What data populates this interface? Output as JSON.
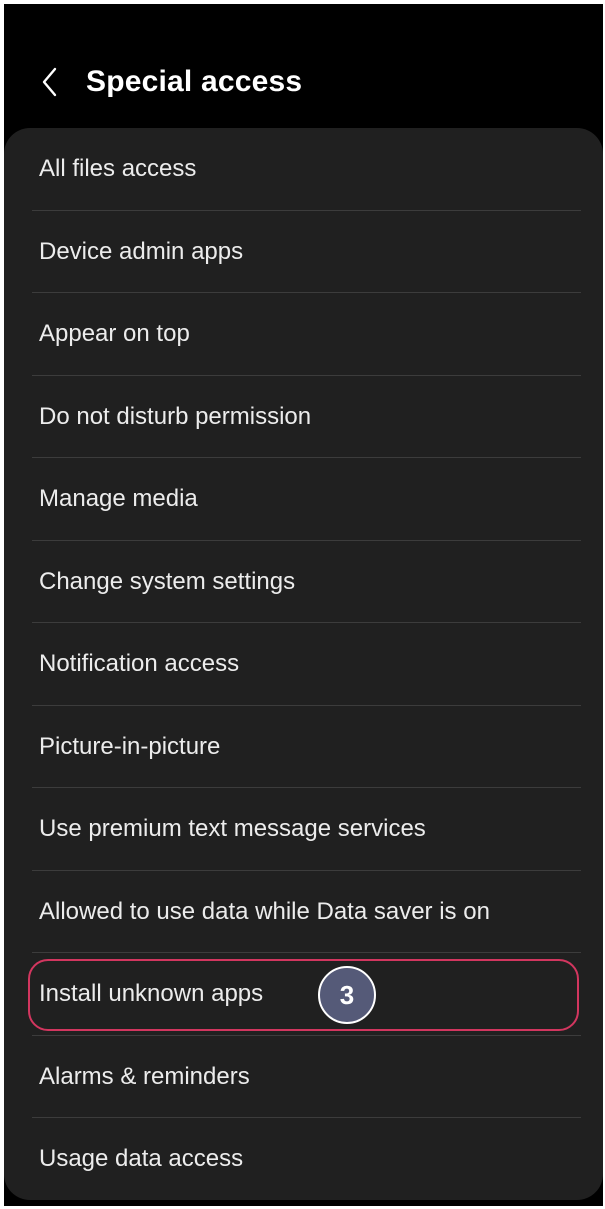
{
  "header": {
    "title": "Special access",
    "back_icon": "chevron-left-icon"
  },
  "items": [
    {
      "label": "All files access"
    },
    {
      "label": "Device admin apps"
    },
    {
      "label": "Appear on top"
    },
    {
      "label": "Do not disturb permission"
    },
    {
      "label": "Manage media"
    },
    {
      "label": "Change system settings"
    },
    {
      "label": "Notification access"
    },
    {
      "label": "Picture-in-picture"
    },
    {
      "label": "Use premium text message services"
    },
    {
      "label": "Allowed to use data while Data saver is on"
    },
    {
      "label": "Install unknown apps",
      "highlighted": true
    },
    {
      "label": "Alarms & reminders"
    },
    {
      "label": "Usage data access"
    }
  ],
  "annotation": {
    "step_number": "3",
    "highlight_color": "#d2365f",
    "badge_color": "#555a78"
  }
}
